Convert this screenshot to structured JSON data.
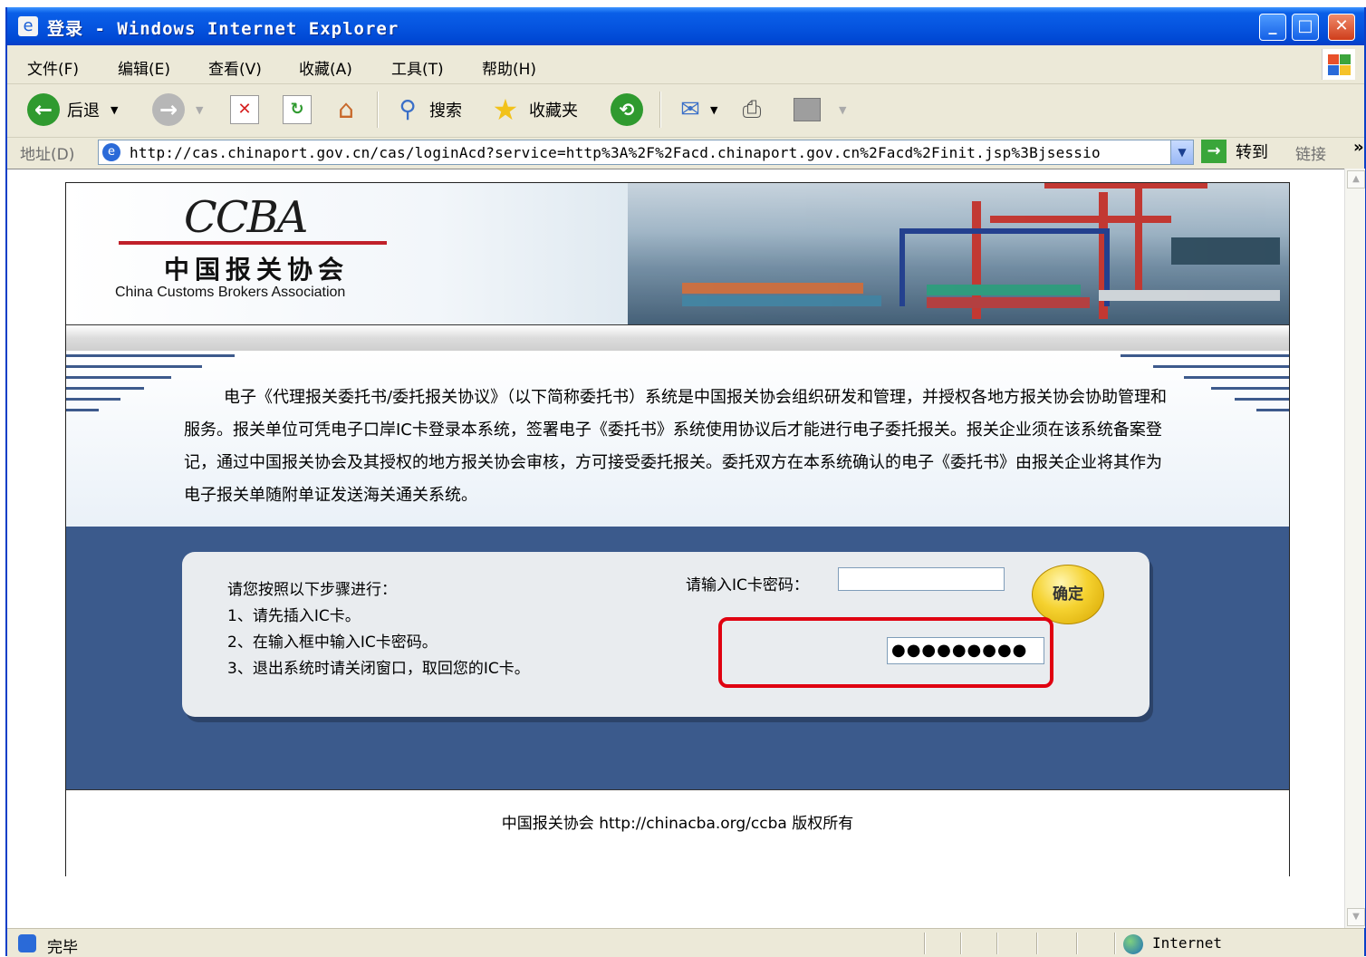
{
  "window": {
    "title": "登录 - Windows Internet Explorer",
    "minimize": "_",
    "maximize": "□",
    "close": "✕"
  },
  "menu": [
    "文件(F)",
    "编辑(E)",
    "查看(V)",
    "收藏(A)",
    "工具(T)",
    "帮助(H)"
  ],
  "toolbar": {
    "back_label": "后退",
    "search_label": "搜索",
    "favorites_label": "收藏夹"
  },
  "address": {
    "label": "地址(D)",
    "url": "http://cas.chinaport.gov.cn/cas/loginAcd?service=http%3A%2F%2Facd.chinaport.gov.cn%2Facd%2Finit.jsp%3Bjsessio",
    "go_label": "转到",
    "links_label": "链接",
    "more_label": "»"
  },
  "page": {
    "logo_text": "CCBA",
    "logo_cn": "中国报关协会",
    "logo_en": "China Customs Brokers Association",
    "intro": "电子《代理报关委托书/委托报关协议》（以下简称委托书）系统是中国报关协会组织研发和管理，并授权各地方报关协会协助管理和服务。报关单位可凭电子口岸IC卡登录本系统，签署电子《委托书》系统使用协议后才能进行电子委托报关。报关企业须在该系统备案登记，通过中国报关协会及其授权的地方报关协会审核，方可接受委托报关。委托双方在本系统确认的电子《委托书》由报关企业将其作为电子报关单随附单证发送海关通关系统。",
    "steps_title": "请您按照以下步骤进行：",
    "step1": "1、请先插入IC卡。",
    "step2": "2、在输入框中输入IC卡密码。",
    "step3": "3、退出系统时请关闭窗口，取回您的IC卡。",
    "password_label": "请输入IC卡密码：",
    "confirm_button": "确定",
    "masked_password": "●●●●●●●●●",
    "footer": "中国报关协会 http://chinacba.org/ccba 版权所有"
  },
  "status": {
    "text": "完毕",
    "zone": "Internet"
  },
  "colors": {
    "titlebar": "#0655e0",
    "page_blue": "#3b5a8c",
    "highlight_red": "#e00010"
  }
}
